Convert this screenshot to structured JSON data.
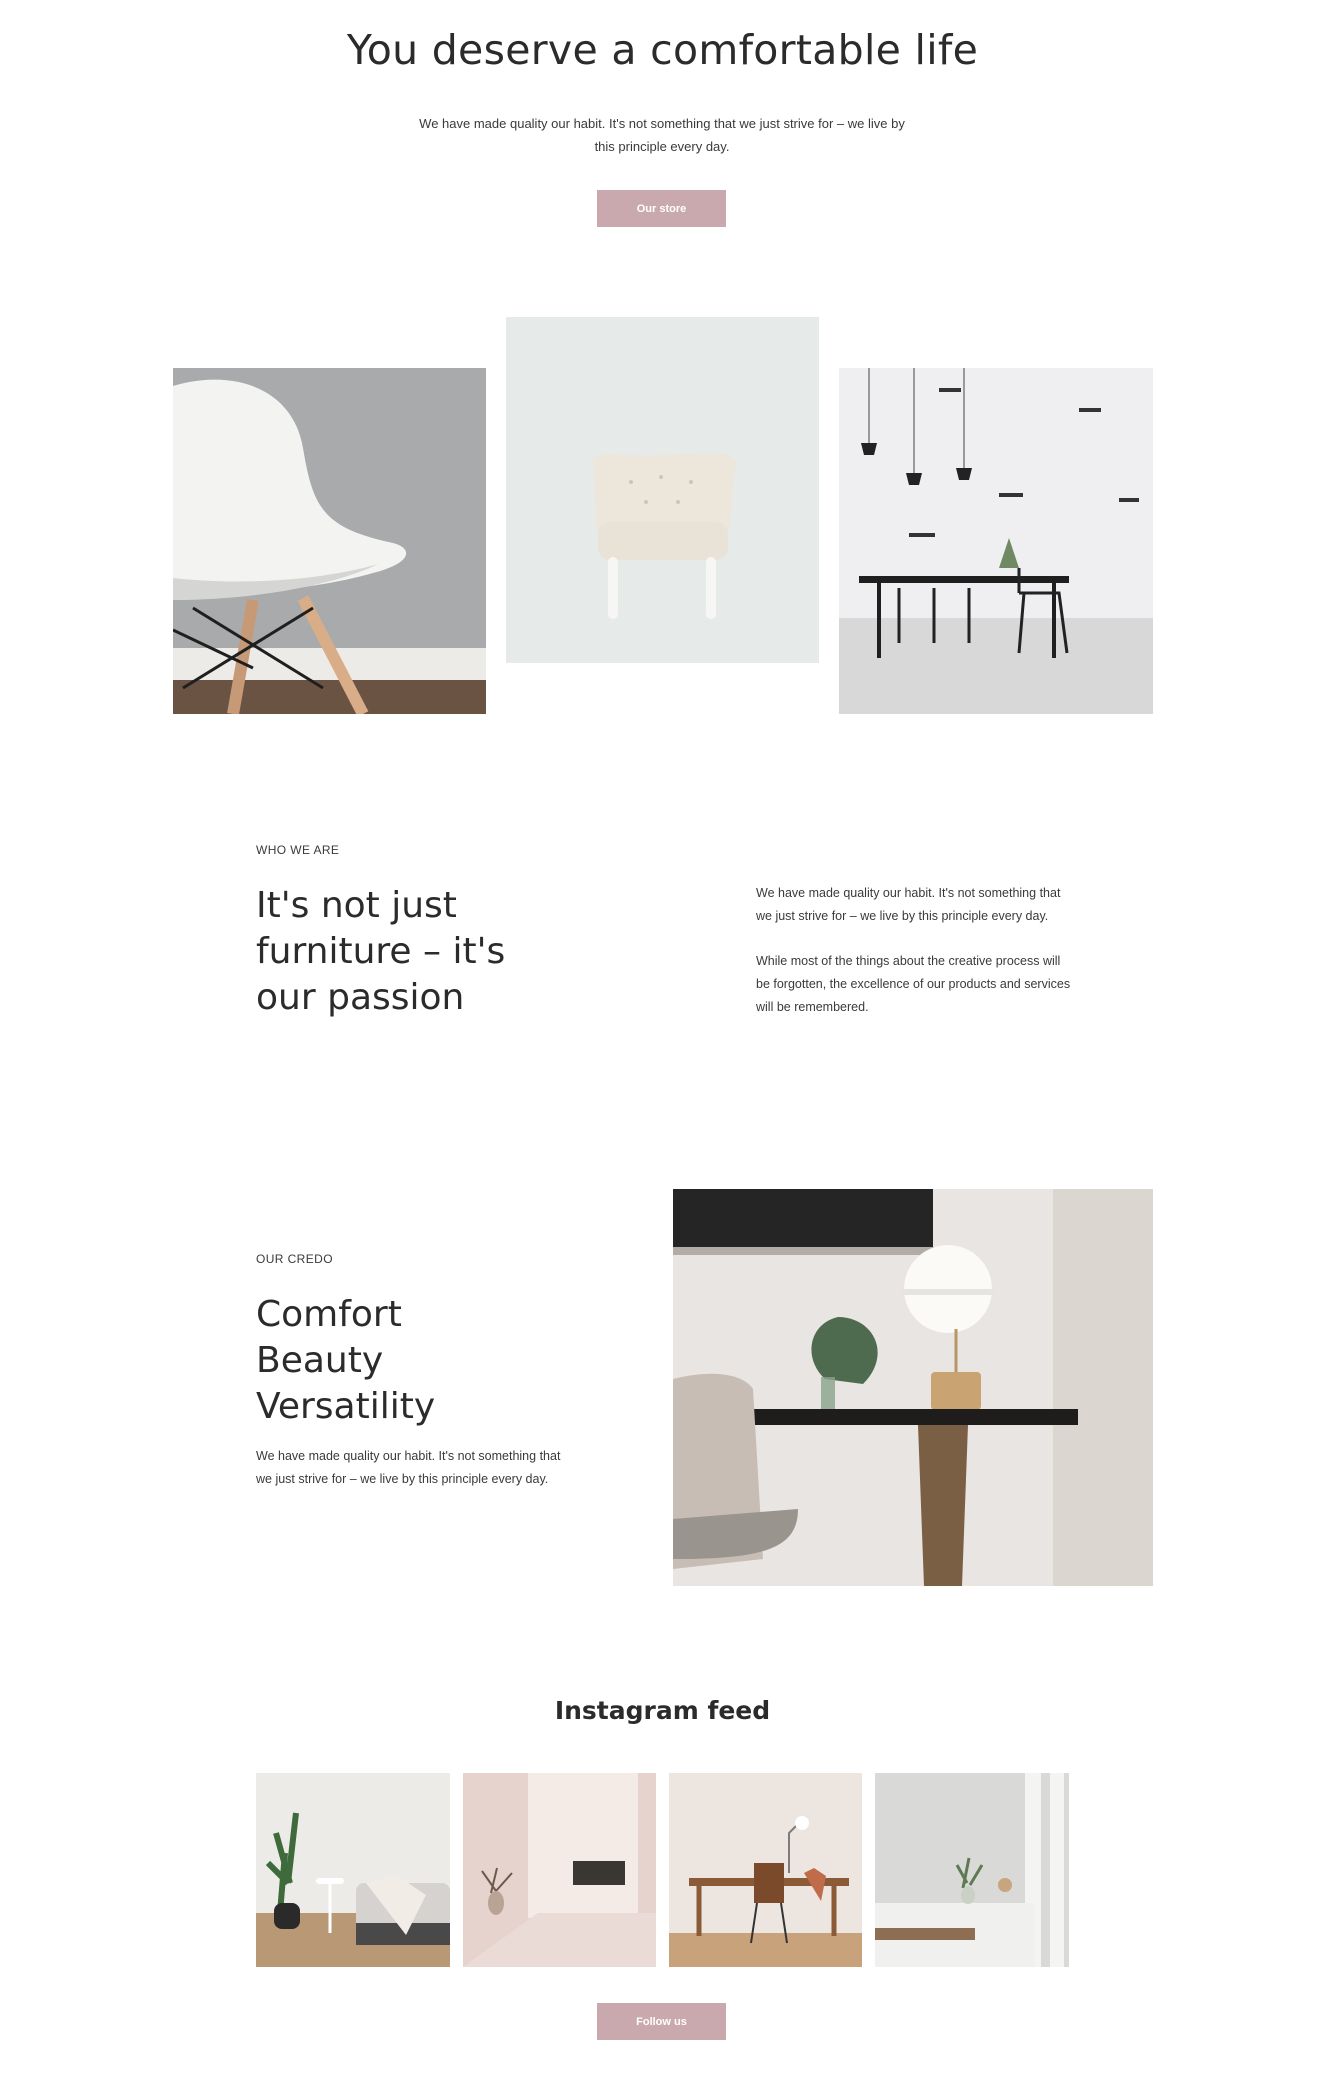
{
  "hero": {
    "title": "You deserve a comfortable life",
    "subtitle": "We have made quality our habit. It's not something that we just strive for – we live by this principle every day.",
    "button_label": "Our store"
  },
  "about": {
    "eyebrow": "WHO WE ARE",
    "heading": "It's not just furniture – it's our passion",
    "paragraph_1": "We have made quality our habit. It's not something that we just strive for – we live by this principle every day.",
    "paragraph_2": "While most of the things about the creative process will be forgotten, the excellence of our products and services will be remembered."
  },
  "credo": {
    "eyebrow": "OUR CREDO",
    "line_1": "Comfort",
    "line_2": "Beauty",
    "line_3": "Versatility",
    "paragraph": "We have made quality our habit. It's not something that we just strive for – we live by this principle every day."
  },
  "instagram": {
    "title": "Instagram feed",
    "button_label": "Follow us"
  },
  "colors": {
    "accent": "#c9a9ad",
    "text": "#2b2b2b"
  }
}
